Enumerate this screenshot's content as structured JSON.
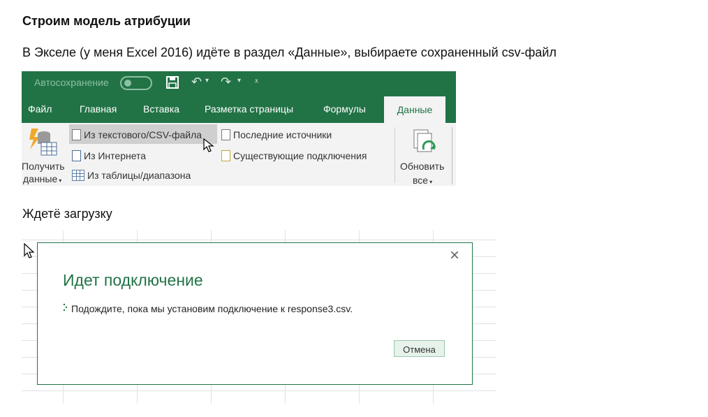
{
  "article": {
    "heading": "Строим модель атрибуции",
    "intro": "В Экселе (у меня Excel 2016) идёте в раздел «Данные», выбираете сохраненный csv-файл",
    "wait_text": "Ждетё загрузку"
  },
  "excel": {
    "autosave_label": "Автосохранение",
    "tabs": [
      "Файл",
      "Главная",
      "Вставка",
      "Разметка страницы",
      "Формулы"
    ],
    "active_tab": "Данные",
    "get_data": {
      "line1": "Получить",
      "line2": "данные"
    },
    "get_transform_items": [
      "Из текстового/CSV-файла",
      "Из Интернета",
      "Из таблицы/диапазона"
    ],
    "recent_items": [
      "Последние источники",
      "Существующие подключения"
    ],
    "refresh": {
      "line1": "Обновить",
      "line2": "все"
    },
    "colors": {
      "ribbon_green": "#217346"
    }
  },
  "dialog": {
    "title": "Идет подключение",
    "message": "Подождите, пока мы установим подключение к response3.csv.",
    "cancel_label": "Отмена",
    "close_icon": "close-icon"
  }
}
